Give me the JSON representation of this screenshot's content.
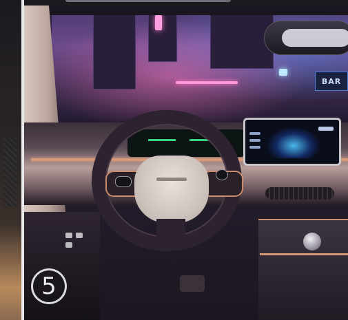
{
  "badge": {
    "number": "5"
  },
  "signage": {
    "bar_sign": "BAR"
  },
  "colors": {
    "accent_trim": "#d6997a",
    "ambient": "#6b4a8a",
    "screen_glow": "#50c8ff"
  },
  "icons": [
    "steering-wheel-icon",
    "gear-knob-icon"
  ]
}
